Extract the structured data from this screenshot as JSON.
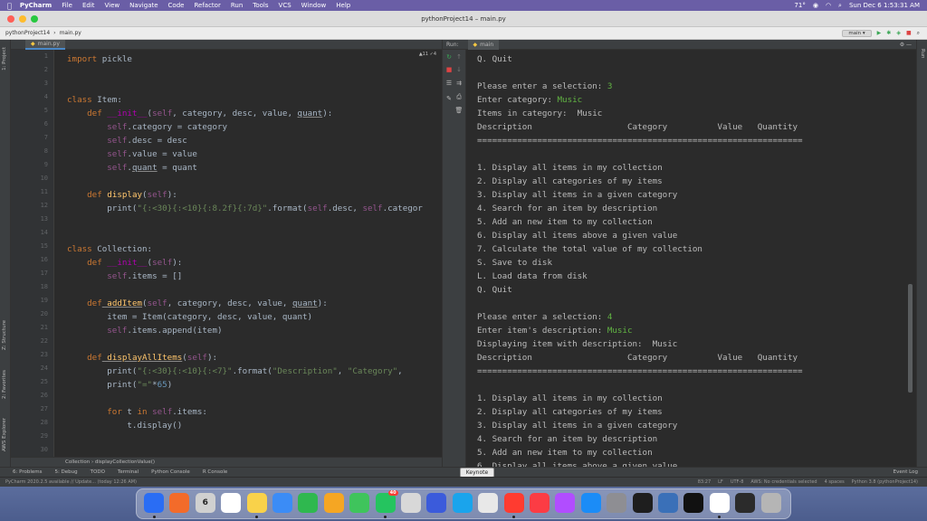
{
  "menubar": {
    "items": [
      "PyCharm",
      "File",
      "Edit",
      "View",
      "Navigate",
      "Code",
      "Refactor",
      "Run",
      "Tools",
      "VCS",
      "Window",
      "Help"
    ],
    "weather": "71°",
    "datetime": "Sun Dec 6  1:53:31 AM"
  },
  "window": {
    "title": "pythonProject14 – main.py"
  },
  "nav": {
    "project": "pythonProject14",
    "file": "main.py",
    "branch": "main"
  },
  "sidebar": {
    "project": "1: Project",
    "structure": "Z: Structure",
    "favorites": "2: Favorites",
    "aws": "AWS Explorer"
  },
  "right_sidebar": {
    "run": "Run"
  },
  "editor": {
    "tab": "main.py",
    "inspections": "▲11 ✓4",
    "lines": [
      {
        "n": "1"
      },
      {
        "n": "2"
      },
      {
        "n": "3"
      },
      {
        "n": "4"
      },
      {
        "n": "5"
      },
      {
        "n": "6"
      },
      {
        "n": "7"
      },
      {
        "n": "8"
      },
      {
        "n": "9"
      },
      {
        "n": "10"
      },
      {
        "n": "11"
      },
      {
        "n": "12"
      },
      {
        "n": "13"
      },
      {
        "n": "14"
      },
      {
        "n": "15"
      },
      {
        "n": "16"
      },
      {
        "n": "17"
      },
      {
        "n": "18"
      },
      {
        "n": "19"
      },
      {
        "n": "20"
      },
      {
        "n": "21"
      },
      {
        "n": "22"
      },
      {
        "n": "23"
      },
      {
        "n": "24"
      },
      {
        "n": "25"
      },
      {
        "n": "26"
      },
      {
        "n": "27"
      },
      {
        "n": "28"
      },
      {
        "n": "29"
      },
      {
        "n": "30"
      }
    ],
    "code": {
      "l1_kw": "import",
      "l1_mod": " pickle",
      "l4_kw": "class",
      "l4_name": " Item:",
      "l5_kw": "def",
      "l5_fn": " __init__",
      "l5_a": "(",
      "l5_self": "self",
      "l5_b": ", category, desc, value, ",
      "l5_q": "quant",
      "l5_c": "):",
      "l6_self": "self",
      "l6_rest": ".category = category",
      "l7_self": "self",
      "l7_rest": ".desc = desc",
      "l8_self": "self",
      "l8_rest": ".value = value",
      "l9_self": "self",
      "l9_a": ".",
      "l9_q": "quant",
      "l9_rest": " = quant",
      "l11_kw": "def",
      "l11_fn": " display",
      "l11_a": "(",
      "l11_self": "self",
      "l11_b": "):",
      "l12_a": "print(",
      "l12_str": "\"{:<30}{:<10}{:8.2f}{:7d}\"",
      "l12_b": ".format(",
      "l12_self": "self",
      "l12_c": ".desc, ",
      "l12_self2": "self",
      "l12_d": ".categor",
      "l15_kw": "class",
      "l15_name": " Collection:",
      "l16_kw": "def",
      "l16_fn": " __init__",
      "l16_a": "(",
      "l16_self": "self",
      "l16_b": "):",
      "l17_self": "self",
      "l17_rest": ".items = []",
      "l19_kw": "def",
      "l19_fn": " addItem",
      "l19_a": "(",
      "l19_self": "self",
      "l19_b": ", category, desc, value, ",
      "l19_q": "quant",
      "l19_c": "):",
      "l20": "item = Item(category, desc, value, quant)",
      "l21_self": "self",
      "l21_rest": ".items.append(item)",
      "l23_kw": "def",
      "l23_fn": " displayAllItems",
      "l23_a": "(",
      "l23_self": "self",
      "l23_b": "):",
      "l24_a": "print(",
      "l24_str": "\"{:<30}{:<10}{:<7}\"",
      "l24_b": ".format(",
      "l24_s1": "\"Description\"",
      "l24_c": ", ",
      "l24_s2": "\"Category\"",
      "l24_d": ",",
      "l25_a": "print(",
      "l25_str": "\"=\"",
      "l25_b": "*",
      "l25_n": "65",
      "l25_c": ")",
      "l27_kw": "for",
      "l27_a": " t ",
      "l27_kw2": "in",
      "l27_self": " self",
      "l27_b": ".items:",
      "l28": "t.display()"
    },
    "breadcrumb": "Collection  ›  displayCollectionValue()"
  },
  "run": {
    "label": "Run:",
    "tab": "main",
    "output": [
      {
        "text": "Q. Quit",
        "input": ""
      },
      {
        "text": "",
        "input": ""
      },
      {
        "text": "Please enter a selection: ",
        "input": "3"
      },
      {
        "text": "Enter category: ",
        "input": "Music"
      },
      {
        "text": "Items in category:  Music",
        "input": ""
      },
      {
        "text": "Description                   Category          Value   Quantity",
        "input": ""
      },
      {
        "text": "=================================================================",
        "input": ""
      },
      {
        "text": "",
        "input": ""
      },
      {
        "text": "1. Display all items in my collection",
        "input": ""
      },
      {
        "text": "2. Display all categories of my items",
        "input": ""
      },
      {
        "text": "3. Display all items in a given category",
        "input": ""
      },
      {
        "text": "4. Search for an item by description",
        "input": ""
      },
      {
        "text": "5. Add an new item to my collection",
        "input": ""
      },
      {
        "text": "6. Display all items above a given value",
        "input": ""
      },
      {
        "text": "7. Calculate the total value of my collection",
        "input": ""
      },
      {
        "text": "S. Save to disk",
        "input": ""
      },
      {
        "text": "L. Load data from disk",
        "input": ""
      },
      {
        "text": "Q. Quit",
        "input": ""
      },
      {
        "text": "",
        "input": ""
      },
      {
        "text": "Please enter a selection: ",
        "input": "4"
      },
      {
        "text": "Enter item's description: ",
        "input": "Music"
      },
      {
        "text": "Displaying item with description:  Music",
        "input": ""
      },
      {
        "text": "Description                   Category          Value   Quantity",
        "input": ""
      },
      {
        "text": "=================================================================",
        "input": ""
      },
      {
        "text": "",
        "input": ""
      },
      {
        "text": "1. Display all items in my collection",
        "input": ""
      },
      {
        "text": "2. Display all categories of my items",
        "input": ""
      },
      {
        "text": "3. Display all items in a given category",
        "input": ""
      },
      {
        "text": "4. Search for an item by description",
        "input": ""
      },
      {
        "text": "5. Add an new item to my collection",
        "input": ""
      },
      {
        "text": "6. Display all items above a given value",
        "input": ""
      }
    ]
  },
  "toolwindows": {
    "items": [
      "6: Problems",
      "5: Debug",
      "TODO",
      "Terminal",
      "Python Console",
      "R Console"
    ],
    "event_log": "Event Log"
  },
  "tooltip": "Keynote",
  "status": {
    "left": "PyCharm 2020.2.5 available // Update... (today 12:26 AM)",
    "pos": "83:27",
    "lf": "LF",
    "enc": "UTF-8",
    "aws": "AWS: No credentials selected",
    "indent": "4 spaces",
    "interp": "Python 3.8 (pythonProject14)"
  },
  "dock": {
    "calendar_day": "6",
    "badge": "40",
    "colors": [
      "#2a6df4",
      "#f36b2a",
      "#d0d0d0",
      "#ffffff",
      "#f9d24a",
      "#3b8cf6",
      "#2fb84f",
      "#f5a623",
      "#3fc45c",
      "#25c45f",
      "#d8d8d8",
      "#3b5bdb",
      "#1aa4ec",
      "#e8e8e8",
      "#ff3b30",
      "#fc3c44",
      "#b14dff",
      "#1b8cf7",
      "#8e8e93",
      "#1e1e1e",
      "#3a70b8",
      "#111111",
      "#ffffff",
      "#2b2b2b",
      "#b5b5b5"
    ]
  }
}
